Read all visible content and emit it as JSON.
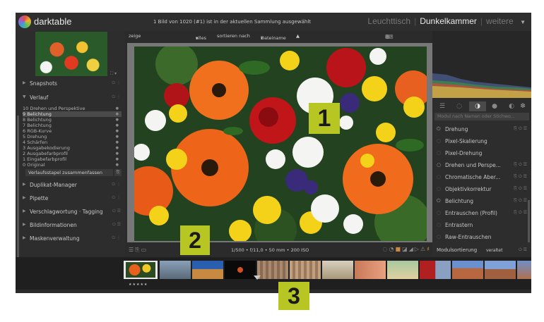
{
  "header": {
    "brand": "darktable",
    "collection_info": "1 Bild von 1020 (#1) ist in der aktuellen Sammlung ausgewählt",
    "views": [
      "Leuchttisch",
      "Dunkelkammer",
      "weitere"
    ],
    "active_view": "Dunkelkammer",
    "menu_icon": "triangle-down-icon"
  },
  "center_top": {
    "show_label": "zeige",
    "filter_value": "alles",
    "sort_label": "sortieren nach",
    "sort_value": "Dateiname",
    "sort_dir_icon": "sort-ascending-icon"
  },
  "left_panel": {
    "sections": {
      "snapshots": "Snapshots",
      "history": "Verlauf",
      "duplicate": "Duplikat-Manager",
      "pipette": "Pipette",
      "tagging": "Verschlagwortung · Tagging",
      "image_info": "Bildinformationen",
      "masks": "Maskenverwaltung"
    },
    "history_items": [
      "10 Drehen und Perspektive",
      "9 Belichtung",
      "8 Belichtung",
      "7 Belichtung",
      "6 RGB-Kurve",
      "5 Drehung",
      "4 Schärfen",
      "3 Ausgabekodierung",
      "2 Ausgabefarbprofil",
      "1 Eingabefarbprofil",
      "0 Original"
    ],
    "selected_history_index": 1,
    "compress_button": "Verlaufsstapel zusammenfassen"
  },
  "center_bottom": {
    "exif": "1/500 • f/11,0 • 50 mm • 200 ISO"
  },
  "right_panel": {
    "search_placeholder": "Modul nach Namen oder Stichwo...",
    "modules": [
      "Drehung",
      "Pixel-Skalierung",
      "Pixel-Drehung",
      "Drehen und Perspe...",
      "Chromatische Aber...",
      "Objektivkorrektur",
      "Belichtung",
      "Entrauschen (Profil)",
      "Entrastern",
      "Raw-Entrauschen"
    ],
    "active_modules": [
      0,
      3,
      6
    ],
    "sort_label": "Modulsortierung",
    "sort_value": "veraltet"
  },
  "filmstrip": {
    "rating": "★★★★★"
  },
  "callouts": [
    "1",
    "2",
    "3"
  ],
  "colors": {
    "callout_bg": "#b8c623",
    "panel_bg": "#2d2d2d"
  }
}
